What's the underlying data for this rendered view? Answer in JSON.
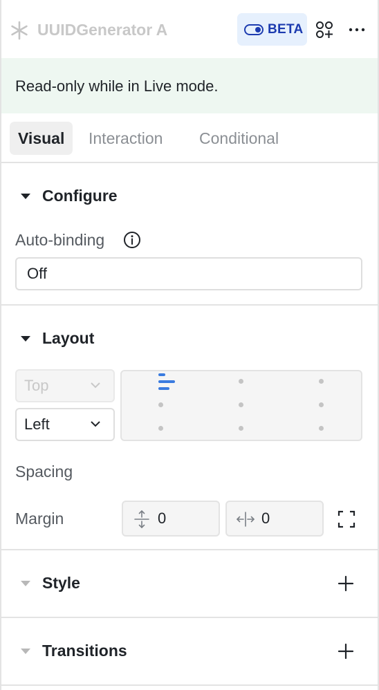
{
  "header": {
    "title": "UUIDGenerator A",
    "beta_label": "BETA"
  },
  "banner": {
    "text": "Read-only while in Live mode."
  },
  "tabs": [
    {
      "label": "Visual",
      "active": true
    },
    {
      "label": "Interaction",
      "active": false
    },
    {
      "label": "Conditional",
      "active": false
    }
  ],
  "configure": {
    "title": "Configure",
    "auto_binding_label": "Auto-binding",
    "auto_binding_value": "Off"
  },
  "layout": {
    "title": "Layout",
    "vertical_align": "Top",
    "horizontal_align": "Left",
    "spacing_label": "Spacing",
    "margin_label": "Margin",
    "margin_vertical": "0",
    "margin_horizontal": "0"
  },
  "style": {
    "title": "Style"
  },
  "transitions": {
    "title": "Transitions"
  },
  "colors": {
    "accent": "#3a7bdf",
    "beta_text": "#1c3bb0",
    "beta_bg": "#e6f0fd",
    "banner_bg": "#eef7f1"
  }
}
